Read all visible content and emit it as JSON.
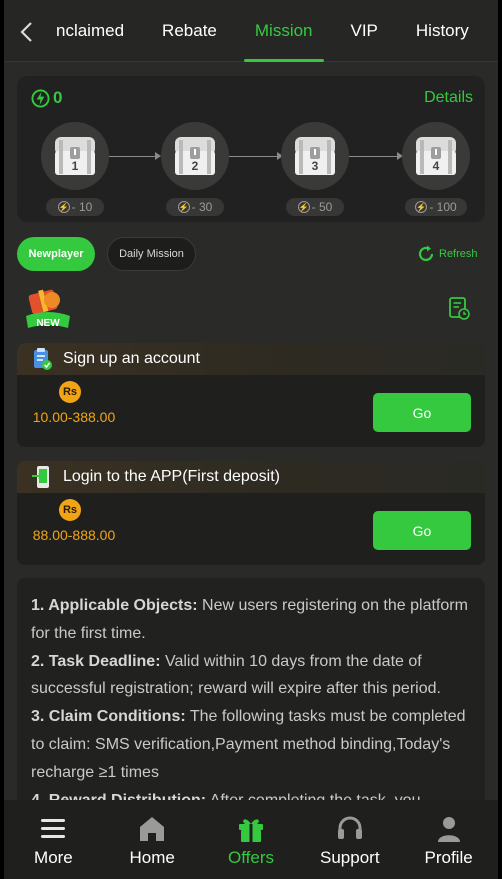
{
  "tabs": [
    "nclaimed",
    "Rebate",
    "Mission",
    "VIP",
    "History"
  ],
  "active_tab": "Mission",
  "chest_panel": {
    "score": "0",
    "details_label": "Details",
    "chests": [
      {
        "num": "1",
        "cost": "- 10"
      },
      {
        "num": "2",
        "cost": "- 30"
      },
      {
        "num": "3",
        "cost": "- 50"
      },
      {
        "num": "4",
        "cost": "- 100"
      }
    ]
  },
  "mission_tabs": {
    "newplayer": "Newplayer",
    "daily": "Daily Mission",
    "refresh": "Refresh"
  },
  "new_badge": "NEW",
  "tasks": [
    {
      "title": "Sign up an account",
      "currency": "Rs",
      "amount": "10.00-388.00",
      "button": "Go"
    },
    {
      "title": "Login to the APP(First deposit)",
      "currency": "Rs",
      "amount": "88.00-888.00",
      "button": "Go"
    }
  ],
  "rules": {
    "r1_head": "1. Applicable Objects:",
    "r1_text": " New users registering on the platform for the first time.",
    "r2_head": "2. Task Deadline:",
    "r2_text": " Valid within 10 days from the date of successful registration; reward will expire after this period.",
    "r3_head": "3. Claim Conditions:",
    "r3_text": " The following tasks must be completed to claim: SMS verification,Payment method binding,Today's recharge ≥1 times",
    "r4_head": "4. Reward Distribution:",
    "r4_text": " After completing the task, you"
  },
  "bottom_nav": [
    "More",
    "Home",
    "Offers",
    "Support",
    "Profile"
  ],
  "colors": {
    "accent": "#35c940",
    "gold": "#f2a416",
    "bg": "#2a2b29"
  }
}
